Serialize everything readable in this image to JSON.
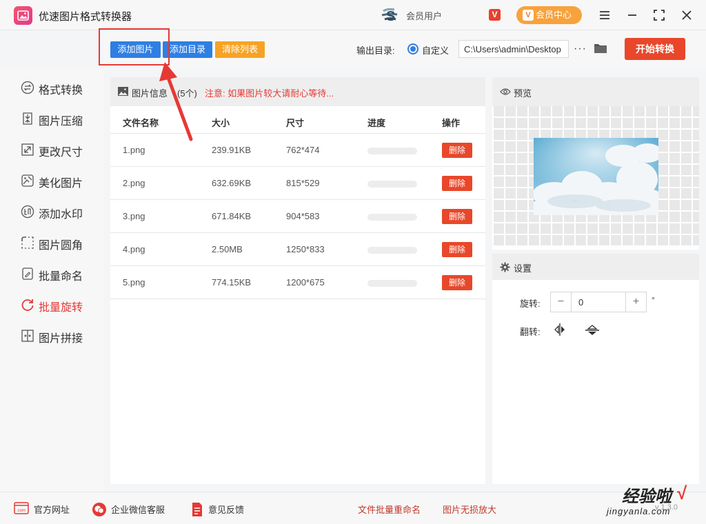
{
  "app": {
    "title": "优速图片格式转换器",
    "user_name": "会员用户",
    "vip_mark": "V",
    "member_center": "会员中心"
  },
  "toolbar": {
    "add_image": "添加图片",
    "add_directory": "添加目录",
    "clear_list": "清除列表",
    "output_dir_label": "输出目录:",
    "custom_label": "自定义",
    "output_path": "C:\\Users\\admin\\Desktop",
    "more": "···",
    "start": "开始转换"
  },
  "sidebar": {
    "items": [
      {
        "label": "格式转换",
        "icon": "format-convert-icon",
        "active": false
      },
      {
        "label": "图片压缩",
        "icon": "compress-icon",
        "active": false
      },
      {
        "label": "更改尺寸",
        "icon": "resize-icon",
        "active": false
      },
      {
        "label": "美化图片",
        "icon": "beautify-icon",
        "active": false
      },
      {
        "label": "添加水印",
        "icon": "watermark-icon",
        "active": false
      },
      {
        "label": "图片圆角",
        "icon": "round-corner-icon",
        "active": false
      },
      {
        "label": "批量命名",
        "icon": "rename-icon",
        "active": false
      },
      {
        "label": "批量旋转",
        "icon": "rotate-icon",
        "active": true
      },
      {
        "label": "图片拼接",
        "icon": "stitch-icon",
        "active": false
      }
    ]
  },
  "file_panel": {
    "title": "图片信息",
    "count": "(5个)",
    "notice": "注意: 如果图片较大请耐心等待...",
    "columns": [
      "文件名称",
      "大小",
      "尺寸",
      "进度",
      "操作"
    ],
    "delete_label": "删除",
    "rows": [
      {
        "name": "1.png",
        "size": "239.91KB",
        "dims": "762*474",
        "progress": 0
      },
      {
        "name": "2.png",
        "size": "632.69KB",
        "dims": "815*529",
        "progress": 0
      },
      {
        "name": "3.png",
        "size": "671.84KB",
        "dims": "904*583",
        "progress": 0
      },
      {
        "name": "4.png",
        "size": "2.50MB",
        "dims": "1250*833",
        "progress": 0
      },
      {
        "name": "5.png",
        "size": "774.15KB",
        "dims": "1200*675",
        "progress": 0
      }
    ]
  },
  "preview": {
    "title": "预览"
  },
  "settings": {
    "title": "设置",
    "rotate_label": "旋转:",
    "rotate_value": "0",
    "degree_symbol": "°",
    "flip_label": "翻转:"
  },
  "footer": {
    "official_site": "官方网址",
    "wechat_service": "企业微信客服",
    "feedback": "意见反馈",
    "batch_rename": "文件批量重命名",
    "lossless_enlarge": "图片无损放大",
    "version": "v 1.3.0"
  },
  "watermark": {
    "title": "经验啦",
    "check": "√",
    "url": "jingyanla.com"
  },
  "colors": {
    "accent_blue": "#2e7fe3",
    "accent_red": "#e8472a",
    "accent_orange": "#f6a325",
    "active_red": "#e53935"
  }
}
